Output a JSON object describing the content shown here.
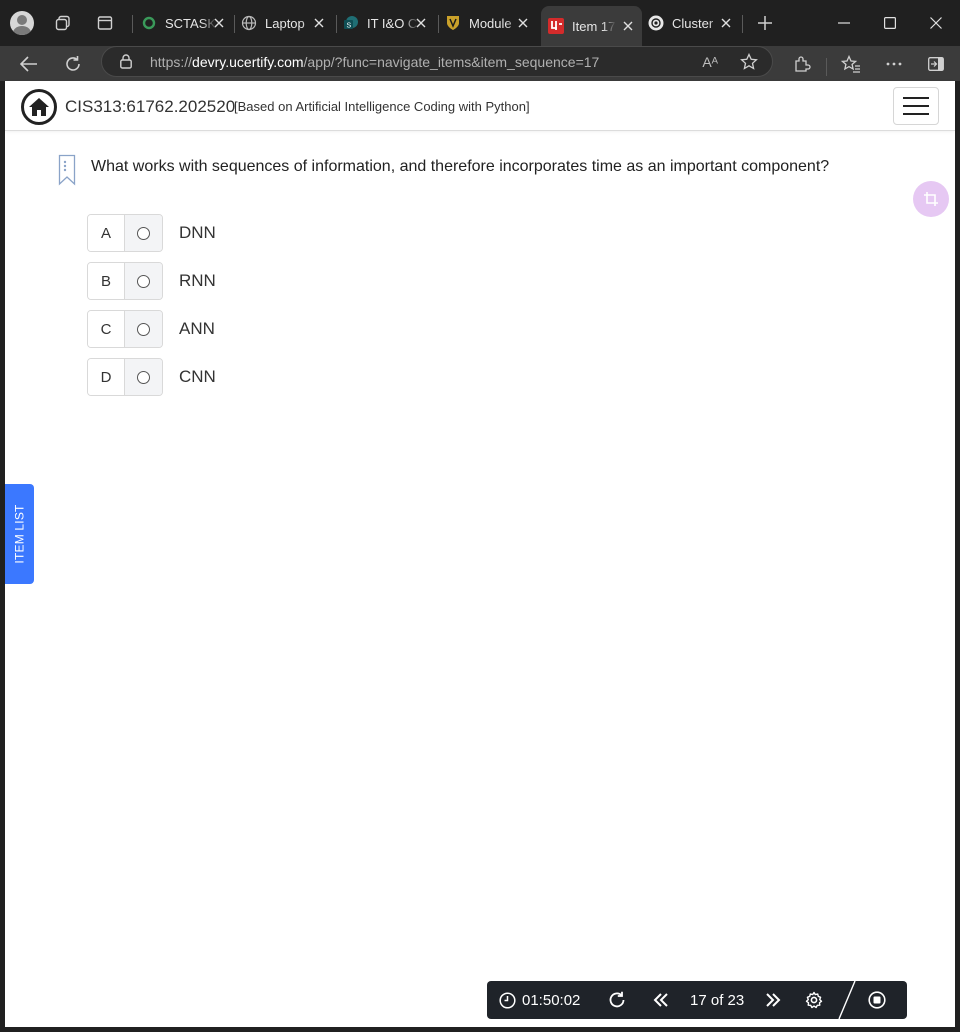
{
  "browser": {
    "tabs": [
      {
        "title": "SCTASK",
        "active": false
      },
      {
        "title": "Laptop",
        "active": false
      },
      {
        "title": "IT I&O C",
        "active": false
      },
      {
        "title": "Module",
        "active": false
      },
      {
        "title": "Item 17",
        "active": true
      },
      {
        "title": "Cluster",
        "active": false
      }
    ],
    "url_prefix": "https://",
    "url_host": "devry.ucertify.com",
    "url_path": "/app/?func=navigate_items&item_sequence=17",
    "read_aloud_label": "Aᴬ"
  },
  "header": {
    "course_code": "CIS313:61762.202520",
    "course_subtitle": "[Based on Artificial Intelligence Coding with Python]"
  },
  "question": {
    "text": "What works with sequences of information, and therefore incorporates time as an important component?",
    "options": [
      {
        "letter": "A",
        "text": "DNN"
      },
      {
        "letter": "B",
        "text": "RNN"
      },
      {
        "letter": "C",
        "text": "ANN"
      },
      {
        "letter": "D",
        "text": "CNN"
      }
    ]
  },
  "sidebar": {
    "item_list_label": "ITEM LIST"
  },
  "footer": {
    "timer": "01:50:02",
    "progress": "17 of 23"
  },
  "colors": {
    "accent_blue": "#3b78ff",
    "crop_fab": "#e6c8f3",
    "footer_bg": "#1f2329"
  }
}
